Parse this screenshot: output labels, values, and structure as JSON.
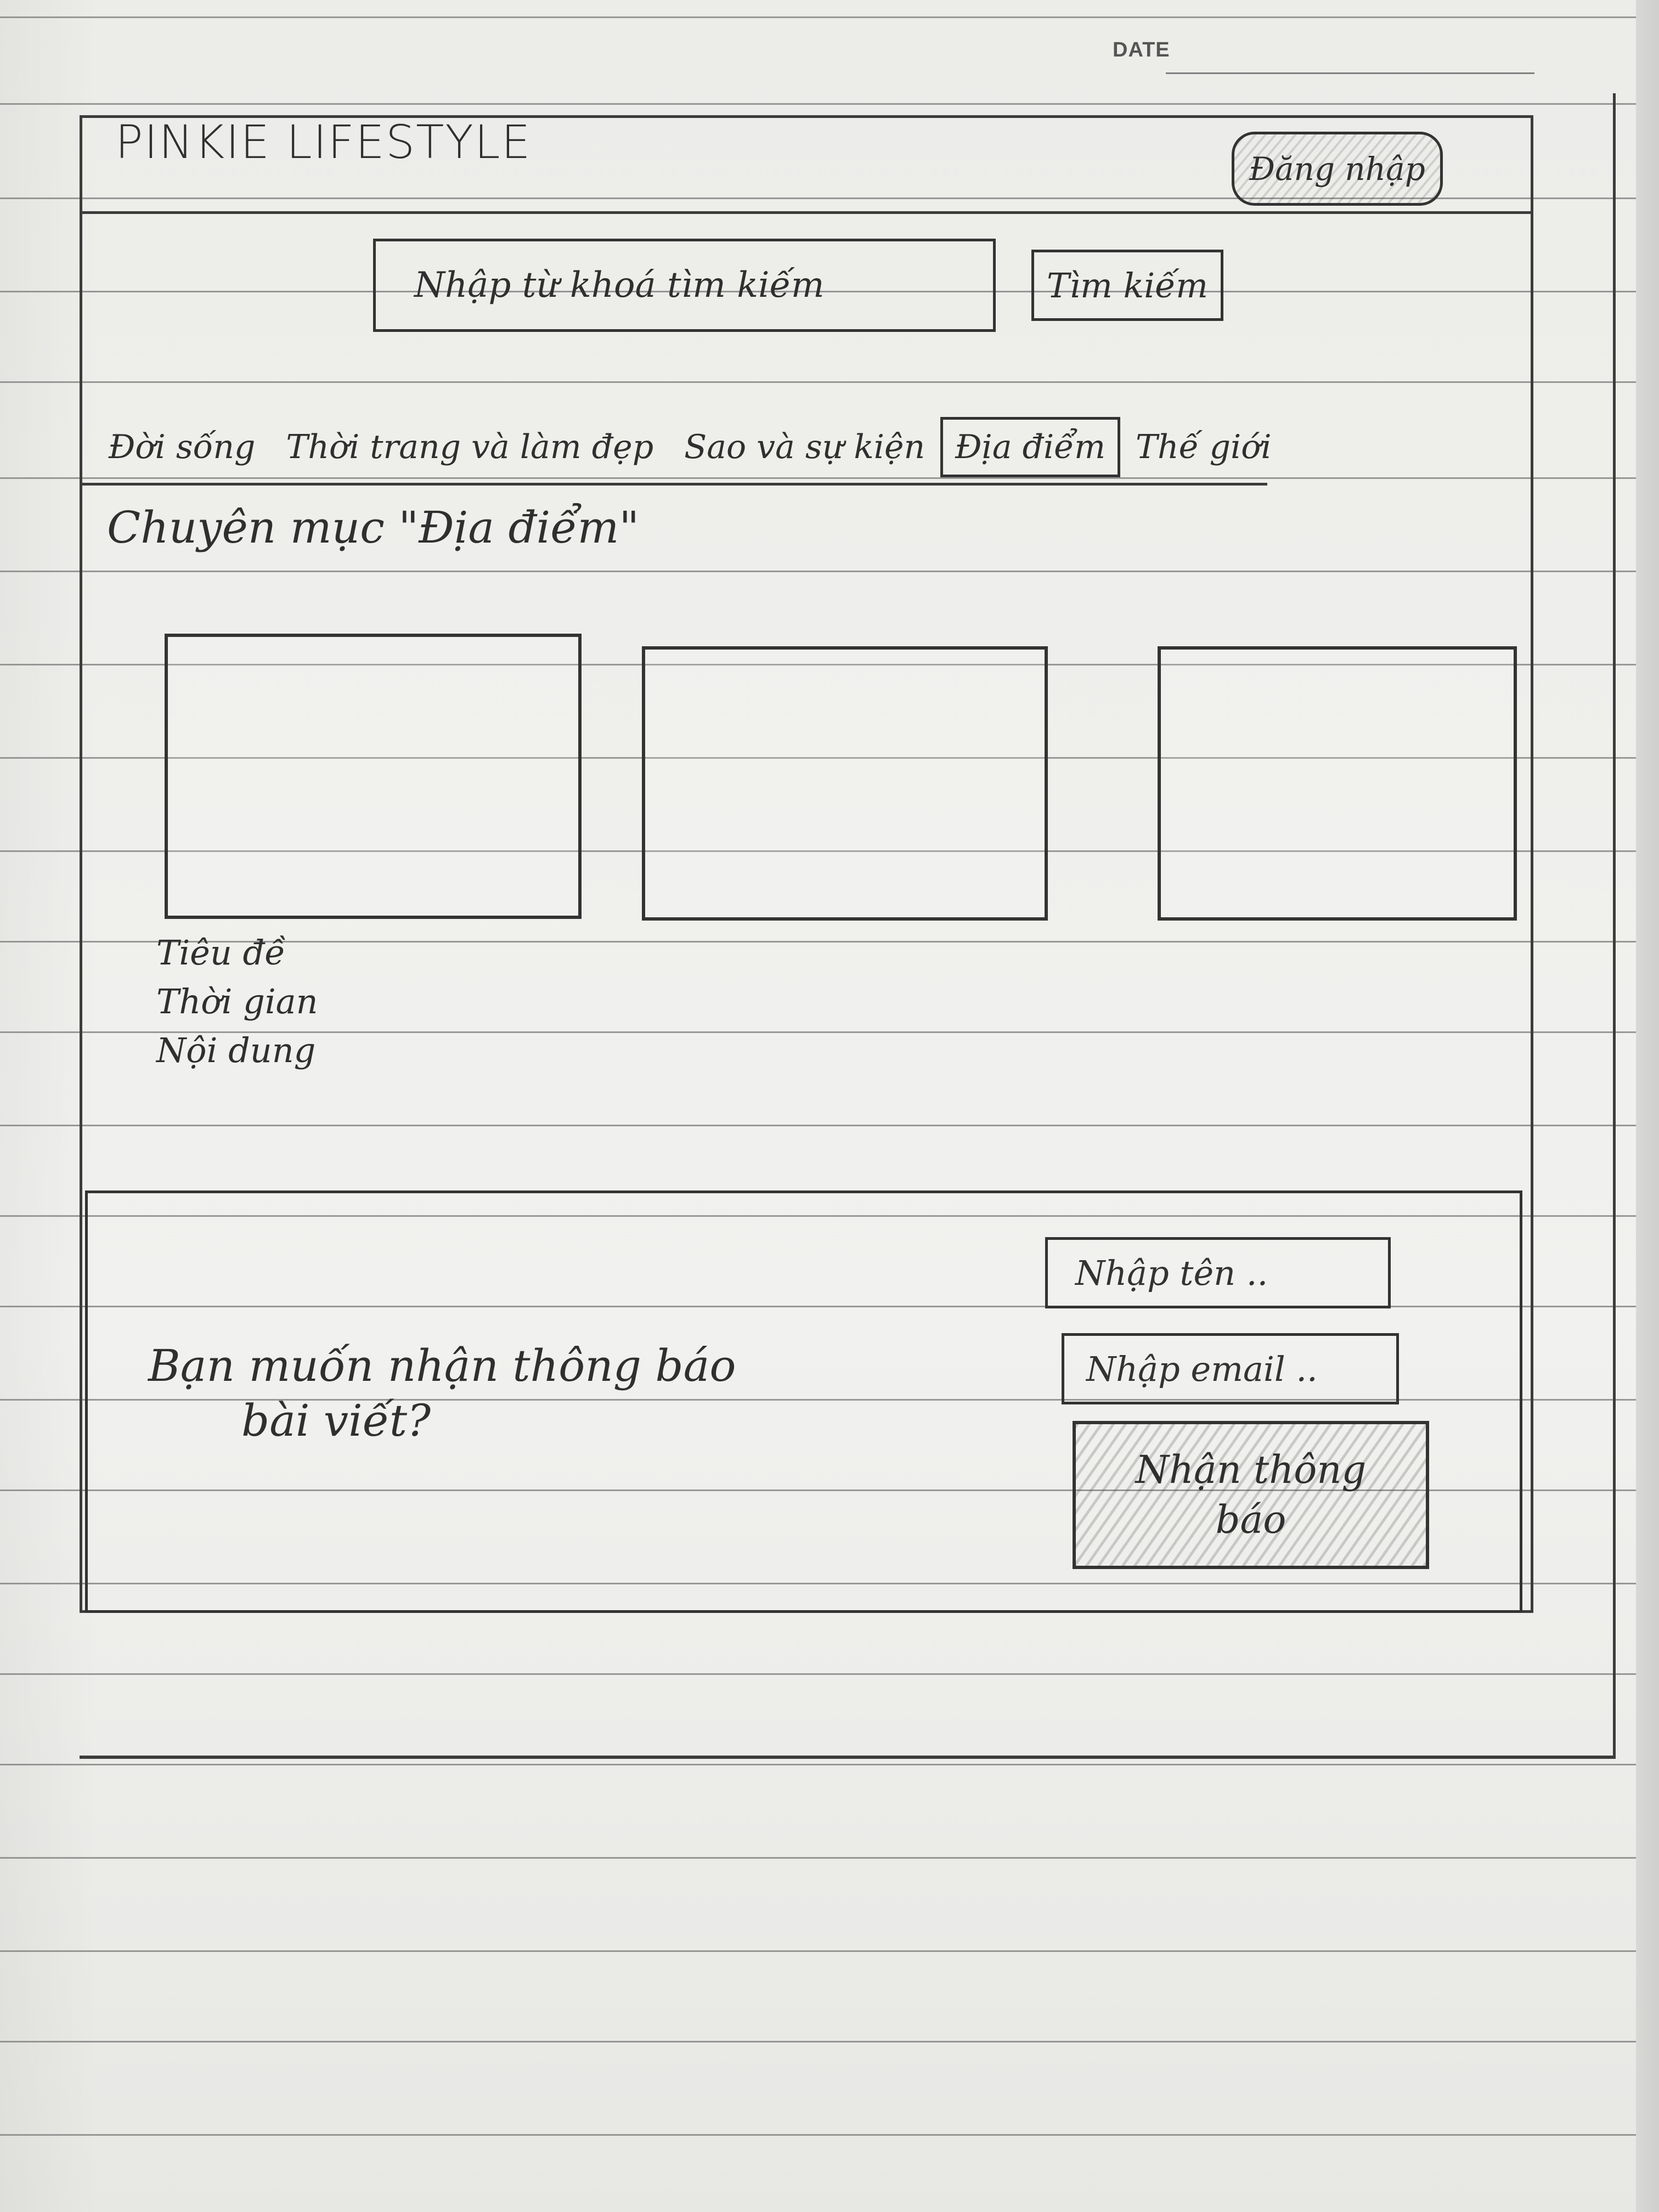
{
  "sheet": {
    "date_label": "DATE"
  },
  "header": {
    "brand": "PINKIE LIFESTYLE",
    "login_label": "Đăng nhập"
  },
  "search": {
    "placeholder": "Nhập từ khoá tìm kiếm",
    "button_label": "Tìm kiếm"
  },
  "nav": {
    "items": [
      {
        "label": "Đời sống",
        "active": false
      },
      {
        "label": "Thời trang và làm đẹp",
        "active": false
      },
      {
        "label": "Sao và sự kiện",
        "active": false
      },
      {
        "label": "Địa điểm",
        "active": true
      },
      {
        "label": "Thế giới",
        "active": false
      }
    ]
  },
  "category": {
    "heading": "Chuyên mục \"Địa điểm\""
  },
  "cards": {
    "meta": {
      "title": "Tiêu đề",
      "time": "Thời gian",
      "content": "Nội dung"
    }
  },
  "subscribe": {
    "question_line1": "Bạn muốn nhận thông báo",
    "question_line2": "bài viết?",
    "name_placeholder": "Nhập tên ..",
    "email_placeholder": "Nhập email ..",
    "button_label": "Nhận thông báo"
  }
}
